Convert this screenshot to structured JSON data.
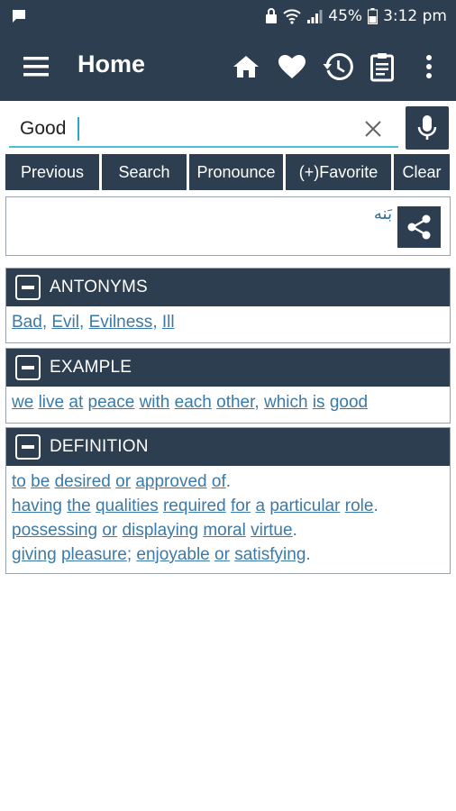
{
  "status_bar": {
    "battery": "45%",
    "time": "3:12 pm",
    "icons": [
      "message-icon",
      "lock-notification-icon",
      "wifi-icon",
      "signal-icon",
      "battery-icon"
    ]
  },
  "app_bar": {
    "title": "Home",
    "icons": [
      "menu-icon",
      "home-icon",
      "heart-icon",
      "history-icon",
      "clipboard-icon",
      "more-vert-icon"
    ]
  },
  "search": {
    "value": "Good",
    "placeholder": ""
  },
  "buttons": {
    "previous": "Previous",
    "search": "Search",
    "pronounce": "Pronounce",
    "favorite": "(+)Favorite",
    "clear": "Clear"
  },
  "translation": {
    "text": "بَنه"
  },
  "antonyms": {
    "title": "ANTONYMS",
    "words": [
      "Bad",
      "Evil",
      "Evilness",
      "Ill"
    ]
  },
  "example": {
    "title": "EXAMPLE",
    "words": [
      "we",
      "live",
      "at",
      "peace",
      "with",
      "each",
      "other",
      "which",
      "is",
      "good"
    ],
    "text": "we live at peace with each other, which is good"
  },
  "definition": {
    "title": "DEFINITION",
    "lines": [
      "to be desired or approved of.",
      "having the qualities required for a particular role.",
      "possessing or displaying moral virtue.",
      "giving pleasure; enjoyable or satisfying."
    ]
  },
  "colors": {
    "primary": "#2d3e50",
    "accent": "#4cbfd8",
    "link": "#3b7aa8",
    "background": "#ffffff"
  }
}
